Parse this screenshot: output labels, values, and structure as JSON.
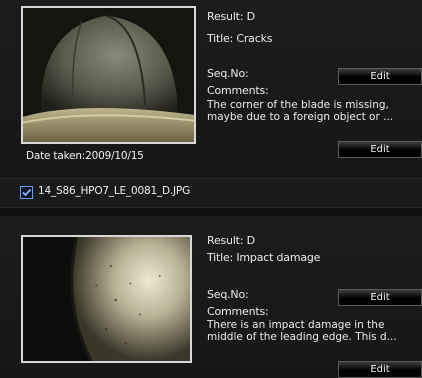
{
  "items": [
    {
      "result": "Result: D",
      "title": "Title: Cracks",
      "seq_label": "Seq.No:",
      "comments_label": "Comments:",
      "comment": "The corner of the blade is missing, maybe due to a foreign object or ...",
      "edit_seq": "Edit",
      "edit_comment": "Edit",
      "date_taken": "Date taken:2009/10/15",
      "selected": true,
      "filename": "14_S86_HPO7_LE_0081_D.JPG"
    },
    {
      "result": "Result: D",
      "title": "Title: Impact damage",
      "seq_label": "Seq.No:",
      "comments_label": "Comments:",
      "comment": "There is an impact damage in the middle of the leading edge. This d...",
      "edit_seq": "Edit",
      "edit_comment": "Edit"
    }
  ],
  "colors": {
    "background": "#141414",
    "checkbox_accent": "#5ea0ff",
    "text": "#ececec"
  }
}
